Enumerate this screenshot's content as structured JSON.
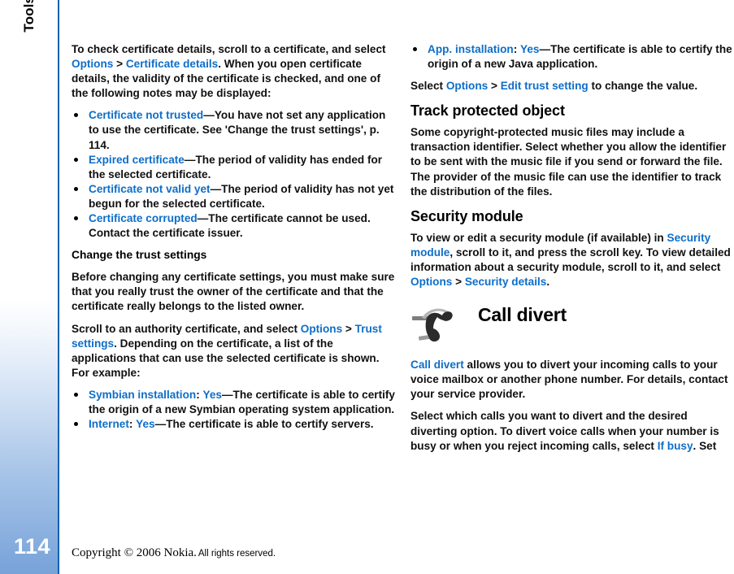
{
  "document": {
    "chapter_tab": "Tools",
    "page_number": "114",
    "footer": {
      "copyright": "Copyright © 2006 Nokia.",
      "rights": "All rights reserved."
    },
    "accent_color": "#0d6ec9",
    "rule_color": "#0a62b0"
  },
  "left_column": {
    "intro": {
      "p1_a": "To check certificate details, scroll to a certificate, and select ",
      "p1_link1": "Options",
      "p1_gt": " > ",
      "p1_link2": "Certificate details",
      "p1_b": ". When you open certificate details, the validity of the certificate is checked, and one of the following notes may be displayed:"
    },
    "notes": [
      {
        "term": "Certificate not trusted",
        "rest": "—You have not set any application to use the certificate. See 'Change the trust settings', p. 114."
      },
      {
        "term": "Expired certificate",
        "rest": "—The period of validity has ended for the selected certificate."
      },
      {
        "term": "Certificate not valid yet",
        "rest": "—The period of validity has not yet begun for the selected certificate."
      },
      {
        "term": "Certificate corrupted",
        "rest": "—The certificate cannot be used. Contact the certificate issuer."
      }
    ],
    "trust_heading": "Change the trust settings",
    "trust_p1": "Before changing any certificate settings, you must make sure that you really trust the owner of the certificate and that the certificate really belongs to the listed owner.",
    "trust_p2": {
      "a": "Scroll to an authority certificate, and select ",
      "link1": "Options",
      "gt": " > ",
      "link2": "Trust settings",
      "b": ". Depending on the certificate, a list of the applications that can use the selected certificate is shown. For example:"
    },
    "examples": [
      {
        "term": "Symbian installation",
        "colon": ": ",
        "value": "Yes",
        "rest": "—The certificate is able to certify the origin of a new Symbian operating system application."
      },
      {
        "term": "Internet",
        "colon": ": ",
        "value": "Yes",
        "rest": "—The certificate is able to certify servers."
      }
    ]
  },
  "right_column": {
    "examples": [
      {
        "term": "App. installation",
        "colon": ": ",
        "value": "Yes",
        "rest": "—The certificate is able to certify the origin of a new Java application."
      }
    ],
    "edit_trust": {
      "a": "Select ",
      "link1": "Options",
      "gt": " > ",
      "link2": "Edit trust setting",
      "b": " to change the value."
    },
    "track_heading": "Track protected object",
    "track_p1": "Some copyright-protected music files may include a transaction identifier. Select whether you allow the identifier to be sent with the music file if you send or forward the file. The provider of the music file can use the identifier to track the distribution of the files.",
    "security_heading": "Security module",
    "security_p1": {
      "a": "To view or edit a security module (if available) in ",
      "link1": "Security module",
      "b": ", scroll to it, and press the scroll key. To view detailed information about a security module, scroll to it, and select ",
      "link2": "Options",
      "gt": " > ",
      "link3": "Security details",
      "c": "."
    },
    "chapter": {
      "title": "Call divert",
      "icon": "call-divert-phone-icon"
    },
    "divert_p1": {
      "link": "Call divert",
      "rest": " allows you to divert your incoming calls to your voice mailbox or another phone number. For details, contact your service provider."
    },
    "divert_p2": {
      "a": "Select which calls you want to divert and the desired diverting option. To divert voice calls when your number is busy or when you reject incoming calls, select ",
      "link": "If busy",
      "b": ". Set"
    }
  }
}
